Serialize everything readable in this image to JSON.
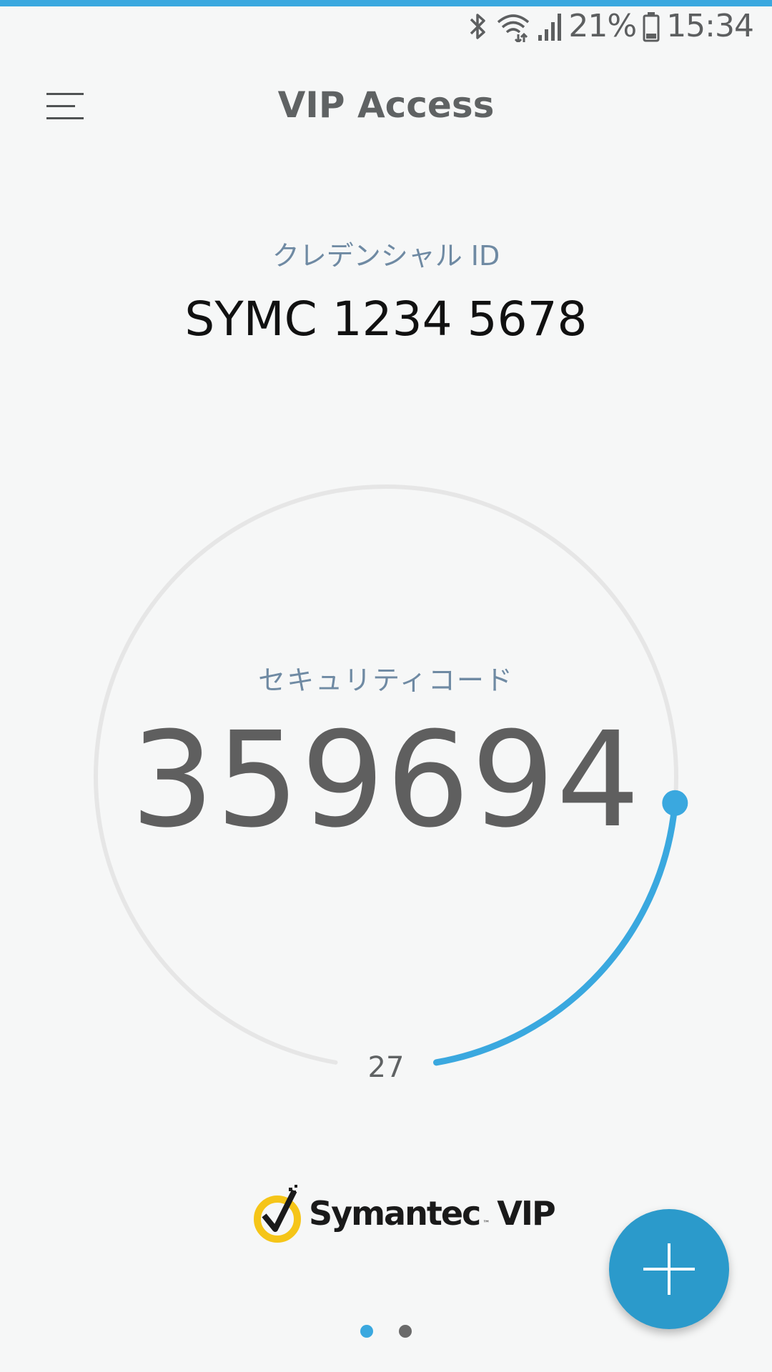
{
  "status_bar": {
    "battery": "21%",
    "time": "15:34"
  },
  "app_bar": {
    "title": "VIP Access"
  },
  "credential": {
    "label": "クレデンシャル ID",
    "id": "SYMC 1234 5678"
  },
  "security_code": {
    "label": "セキュリティコード",
    "value": "359694"
  },
  "timer": {
    "seconds_remaining": "27",
    "progress_fraction": 0.22
  },
  "logo": {
    "text": "Symantec",
    "tm": "™",
    "product": "VIP"
  },
  "pager": {
    "pages": 2,
    "active": 0
  },
  "colors": {
    "accent": "#3aa8df",
    "fab": "#2b9acb",
    "ring_track": "#e6e6e6",
    "label_blue": "#6f8aa3",
    "dot_inactive": "#6a6a6a",
    "logo_yellow": "#f5c518"
  },
  "icons": {
    "menu": "hamburger-menu-icon",
    "add": "plus-icon",
    "bluetooth": "bluetooth-icon",
    "wifi": "wifi-icon",
    "signal": "signal-icon",
    "battery": "battery-icon"
  }
}
